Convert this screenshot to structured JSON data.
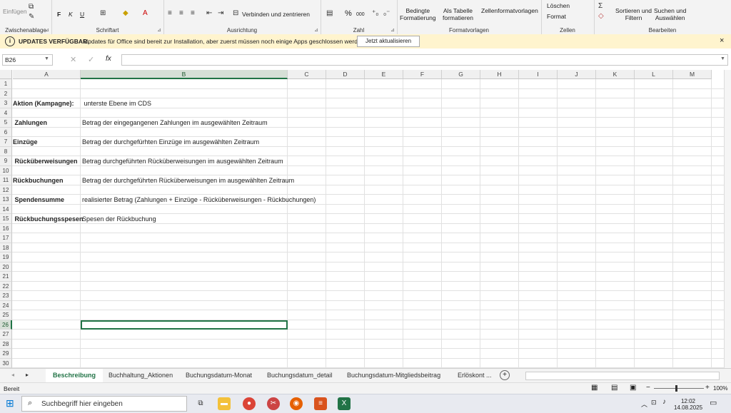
{
  "ribbon": {
    "clipboard": {
      "paste": "Einfügen",
      "label": "Zwischenablage"
    },
    "font": {
      "bold": "F",
      "italic": "K",
      "underline": "U",
      "label": "Schriftart"
    },
    "alignment": {
      "merge": "Verbinden und zentrieren",
      "label": "Ausrichtung"
    },
    "number": {
      "percent": "%",
      "thousands": "000",
      "label": "Zahl"
    },
    "styles": {
      "conditional": "Bedingte\nFormatierung",
      "table": "Als Tabelle\nformatieren",
      "cellstyles": "Zellenformatvorlagen",
      "label": "Formatvorlagen"
    },
    "cells": {
      "delete": "Löschen",
      "format": "Format",
      "label": "Zellen"
    },
    "editing": {
      "sort": "Sortieren und\nFiltern",
      "find": "Suchen und\nAuswählen",
      "label": "Bearbeiten"
    }
  },
  "update_bar": {
    "title": "UPDATES VERFÜGBAR.",
    "message": "Updates für Office sind bereit zur Installation, aber zuerst müssen noch einige Apps geschlossen werden.",
    "button": "Jetzt aktualisieren",
    "close": "×"
  },
  "formula_bar": {
    "name_box": "B26",
    "fx": "fx",
    "content": ""
  },
  "columns": [
    "A",
    "B",
    "C",
    "D",
    "E",
    "F",
    "G",
    "H",
    "I",
    "J",
    "K",
    "L",
    "M"
  ],
  "selected_column": "B",
  "selected_row": 26,
  "rows": [
    {
      "n": 1,
      "a": "",
      "b": ""
    },
    {
      "n": 2,
      "a": "",
      "b": ""
    },
    {
      "n": 3,
      "a": "Aktion (Kampagne):",
      "b": " unterste Ebene im CDS"
    },
    {
      "n": 4,
      "a": "",
      "b": ""
    },
    {
      "n": 5,
      "a": " Zahlungen",
      "b": "Betrag der eingegangenen Zahlungen im ausgewählten Zeitraum"
    },
    {
      "n": 6,
      "a": "",
      "b": ""
    },
    {
      "n": 7,
      "a": "Einzüge",
      "b": "Betrag der durchgefürhten Einzüge im ausgewählten Zeitraum"
    },
    {
      "n": 8,
      "a": "",
      "b": ""
    },
    {
      "n": 9,
      "a": " Rücküberweisungen",
      "b": "Betrag durchgeführten Rücküberweisungen im ausgewählten Zeitraum"
    },
    {
      "n": 10,
      "a": "",
      "b": ""
    },
    {
      "n": 11,
      "a": "Rückbuchungen",
      "b": "Betrag der durchgeführten Rücküberweisungen im ausgewählten Zeitraum"
    },
    {
      "n": 12,
      "a": "",
      "b": ""
    },
    {
      "n": 13,
      "a": " Spendensumme",
      "b": "realisierter Betrag (Zahlungen + Einzüge - Rücküberweisungen - Rückbuchungen)"
    },
    {
      "n": 14,
      "a": "",
      "b": ""
    },
    {
      "n": 15,
      "a": " Rückbuchungsspesen",
      "b": "Spesen der Rückbuchung"
    },
    {
      "n": 16,
      "a": "",
      "b": ""
    },
    {
      "n": 17,
      "a": "",
      "b": ""
    },
    {
      "n": 18,
      "a": "",
      "b": ""
    },
    {
      "n": 19,
      "a": "",
      "b": ""
    },
    {
      "n": 20,
      "a": "",
      "b": ""
    },
    {
      "n": 21,
      "a": "",
      "b": ""
    },
    {
      "n": 22,
      "a": "",
      "b": ""
    },
    {
      "n": 23,
      "a": "",
      "b": ""
    },
    {
      "n": 24,
      "a": "",
      "b": ""
    },
    {
      "n": 25,
      "a": "",
      "b": ""
    },
    {
      "n": 26,
      "a": "",
      "b": ""
    },
    {
      "n": 27,
      "a": "",
      "b": ""
    },
    {
      "n": 28,
      "a": "",
      "b": ""
    },
    {
      "n": 29,
      "a": "",
      "b": ""
    },
    {
      "n": 30,
      "a": "",
      "b": ""
    }
  ],
  "sheet_tabs": [
    "Beschreibung",
    "Buchhaltung_Aktionen",
    "Buchungsdatum-Monat",
    "Buchungsdatum_detail",
    "Buchungsdatum-Mitgliedsbeitrag",
    "Erlöskont ..."
  ],
  "active_tab": "Beschreibung",
  "status": {
    "mode": "Bereit",
    "zoom": "100%"
  },
  "taskbar": {
    "search_placeholder": "Suchbegriff hier eingeben",
    "time": "12:02",
    "date": "14.08.2025"
  },
  "colors": {
    "accent": "#217346",
    "update_bg": "#fff4ce"
  }
}
